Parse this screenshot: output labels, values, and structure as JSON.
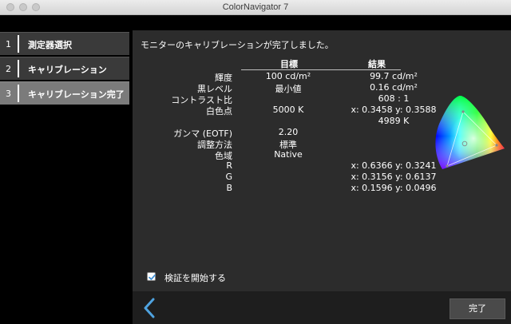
{
  "window": {
    "title": "ColorNavigator 7"
  },
  "sidebar": {
    "steps": [
      {
        "num": "1",
        "label": "測定器選択"
      },
      {
        "num": "2",
        "label": "キャリブレーション"
      },
      {
        "num": "3",
        "label": "キャリブレーション完了"
      }
    ],
    "active_step": 3
  },
  "main": {
    "heading": "モニターのキャリブレーションが完了しました。",
    "columns": {
      "target": "目標",
      "result": "結果"
    },
    "rows": [
      {
        "label": "輝度",
        "target": "100 cd/m²",
        "result": "99.7 cd/m²"
      },
      {
        "label": "黒レベル",
        "target": "最小値",
        "result": "0.16 cd/m²"
      },
      {
        "label": "コントラスト比",
        "target": "",
        "result": "608 : 1"
      },
      {
        "label": "白色点",
        "target": "5000 K",
        "result": "x: 0.3458  y: 0.3588",
        "result2": "4989 K"
      },
      {
        "label": "ガンマ (EOTF)",
        "target": "2.20",
        "result": ""
      },
      {
        "label": "調整方法",
        "target": "標準",
        "result": ""
      },
      {
        "label": "色域",
        "target": "Native",
        "result": ""
      },
      {
        "label": "R",
        "target": "",
        "result": "x: 0.6366  y: 0.3241"
      },
      {
        "label": "G",
        "target": "",
        "result": "x: 0.3156  y: 0.6137"
      },
      {
        "label": "B",
        "target": "",
        "result": "x: 0.1596  y: 0.0496"
      }
    ],
    "verify": {
      "label": "検証を開始する",
      "checked": true
    }
  },
  "footer": {
    "back_icon": "chevron-left-icon",
    "done_label": "完了"
  },
  "colors": {
    "accent": "#4fa3e0",
    "panel": "#2c2c2c",
    "active_step": "#7b7b7b"
  }
}
